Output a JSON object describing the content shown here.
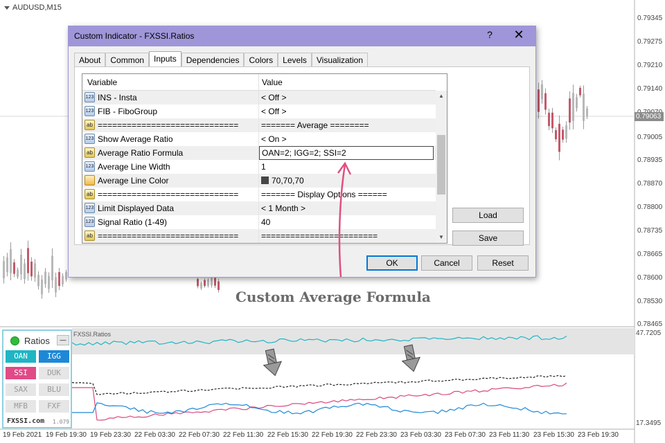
{
  "chart": {
    "symbol": "AUDUSD,M15",
    "price_labels": [
      "0.79345",
      "0.79275",
      "0.79210",
      "0.79140",
      "0.79070",
      "0.79005",
      "0.78935",
      "0.78870",
      "0.78800",
      "0.78735",
      "0.78665",
      "0.78600",
      "0.78530",
      "0.78465"
    ],
    "current_price": "0.79063",
    "time_labels": [
      "19 Feb 2021",
      "19 Feb 19:30",
      "19 Feb 23:30",
      "22 Feb 03:30",
      "22 Feb 07:30",
      "22 Feb 11:30",
      "22 Feb 15:30",
      "22 Feb 19:30",
      "22 Feb 23:30",
      "23 Feb 03:30",
      "23 Feb 07:30",
      "23 Feb 11:30",
      "23 Feb 15:30",
      "23 Feb 19:30"
    ]
  },
  "dialog": {
    "title": "Custom Indicator - FXSSI.Ratios",
    "help": "?",
    "close": "✕",
    "tabs": [
      {
        "label": "About",
        "active": false
      },
      {
        "label": "Common",
        "active": false
      },
      {
        "label": "Inputs",
        "active": true
      },
      {
        "label": "Dependencies",
        "active": false
      },
      {
        "label": "Colors",
        "active": false
      },
      {
        "label": "Levels",
        "active": false
      },
      {
        "label": "Visualization",
        "active": false
      }
    ],
    "grid": {
      "col_variable": "Variable",
      "col_value": "Value",
      "rows": [
        {
          "icon": "num",
          "variable": "INS - Insta",
          "value": "< Off >"
        },
        {
          "icon": "num",
          "variable": "FIB - FiboGroup",
          "value": "< Off >"
        },
        {
          "icon": "ab",
          "variable": "=============================",
          "value": "======= Average ========"
        },
        {
          "icon": "num",
          "variable": "Show Average Ratio",
          "value": "< On >"
        },
        {
          "icon": "ab",
          "variable": "Average Ratio Formula",
          "value": "OAN=2; IGG=2; SSI=2",
          "editing": true
        },
        {
          "icon": "num",
          "variable": "Average Line Width",
          "value": "1"
        },
        {
          "icon": "color",
          "variable": "Average Line Color",
          "value": "70,70,70",
          "swatch": "#464646"
        },
        {
          "icon": "ab",
          "variable": "=============================",
          "value": "======= Display Options ======"
        },
        {
          "icon": "num",
          "variable": "Limit Displayed Data",
          "value": "< 1 Month >"
        },
        {
          "icon": "num",
          "variable": "Signal Ratio (1-49)",
          "value": "40"
        },
        {
          "icon": "ab",
          "variable": "=============================",
          "value": "========================"
        }
      ]
    },
    "buttons": {
      "load": "Load",
      "save": "Save",
      "ok": "OK",
      "cancel": "Cancel",
      "reset": "Reset"
    }
  },
  "caption": "Custom Average Formula",
  "indicator": {
    "title": "FXSSI.Ratios",
    "axis_top": "47.7205",
    "axis_bottom": "17.3495",
    "panel": {
      "title": "Ratios",
      "minimize": "—",
      "buttons": [
        {
          "label": "OAN",
          "bg": "#1fb5c4",
          "fg": "#ffffff"
        },
        {
          "label": "IGG",
          "bg": "#1e88d6",
          "fg": "#ffffff"
        },
        {
          "label": "SSI",
          "bg": "#e04a86",
          "fg": "#ffffff"
        },
        {
          "label": "DUK",
          "bg": "#e6e6e6",
          "fg": "#9a9a9a"
        },
        {
          "label": "SAX",
          "bg": "#e6e6e6",
          "fg": "#9a9a9a"
        },
        {
          "label": "BLU",
          "bg": "#e6e6e6",
          "fg": "#9a9a9a"
        },
        {
          "label": "MFB",
          "bg": "#e6e6e6",
          "fg": "#9a9a9a"
        },
        {
          "label": "FXF",
          "bg": "#e6e6e6",
          "fg": "#9a9a9a"
        }
      ],
      "site": "FXSSI.com",
      "version": "1.079"
    }
  },
  "colors": {
    "dialog_title": "#9e96d8",
    "arrow": "#e0507e",
    "oan": "#1fb5c4",
    "igg": "#1e88d6",
    "ssi": "#d8487e",
    "candle_bull": "#b8b8b8",
    "candle_bear": "#c45a6a"
  }
}
